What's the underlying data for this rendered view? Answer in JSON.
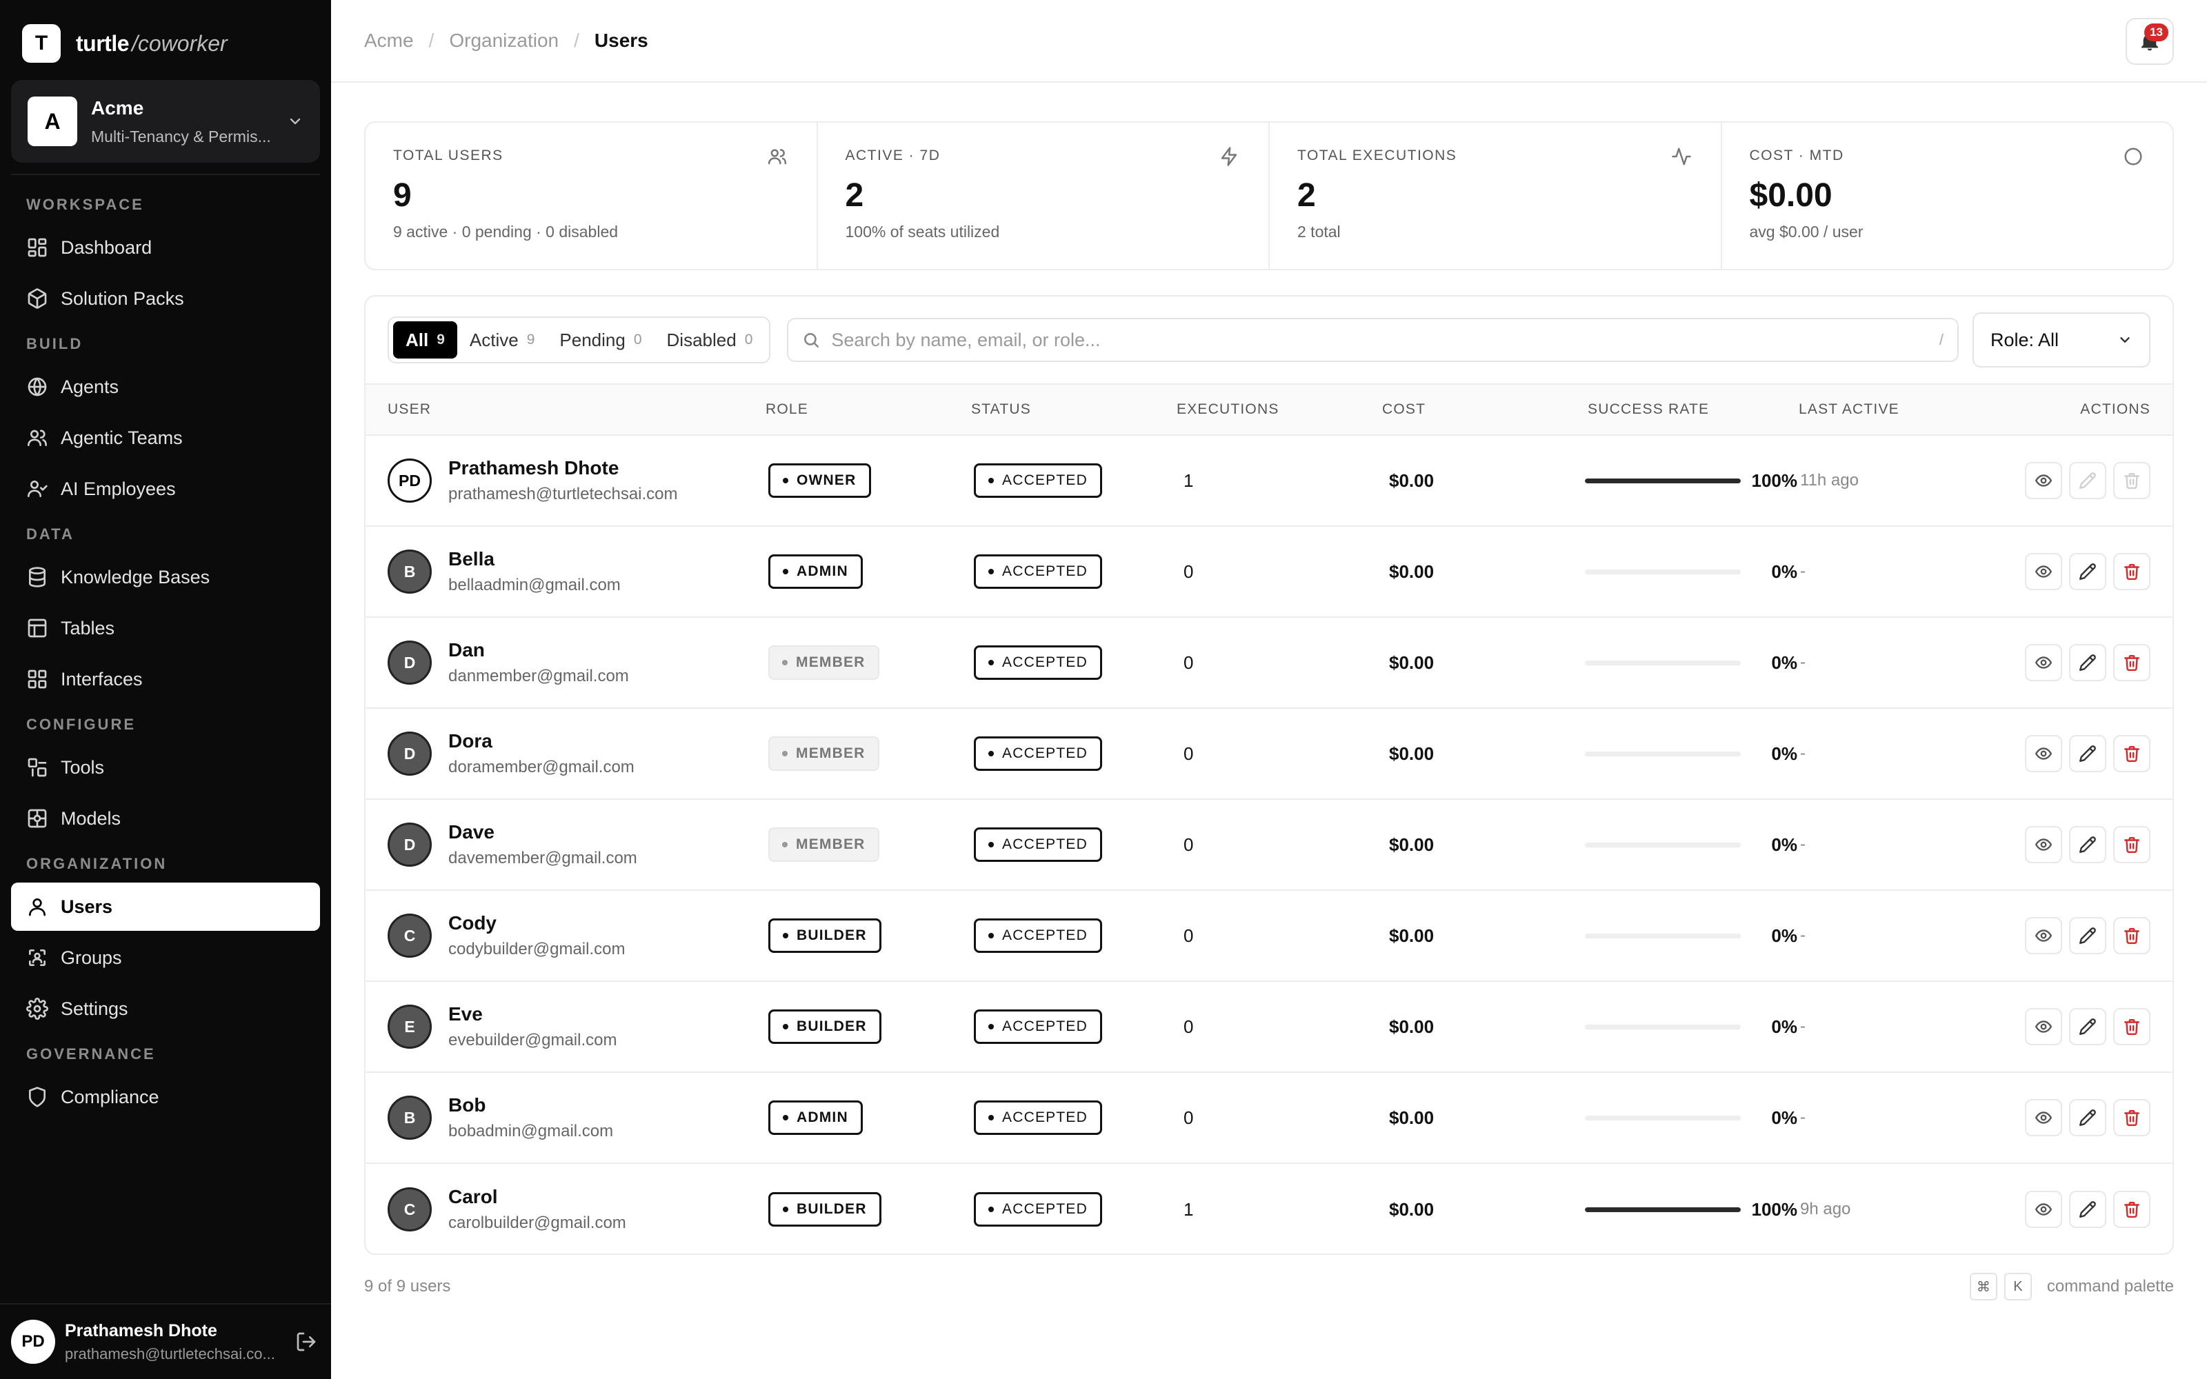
{
  "brand": {
    "logo_letter": "T",
    "name": "turtle",
    "suffix": "/coworker"
  },
  "org": {
    "avatar": "A",
    "name": "Acme",
    "subtitle": "Multi-Tenancy & Permis..."
  },
  "nav": {
    "sections": [
      {
        "title": "WORKSPACE",
        "items": [
          {
            "label": "Dashboard",
            "icon": "dashboard-icon"
          },
          {
            "label": "Solution Packs",
            "icon": "package-icon"
          }
        ]
      },
      {
        "title": "BUILD",
        "items": [
          {
            "label": "Agents",
            "icon": "globe-icon"
          },
          {
            "label": "Agentic Teams",
            "icon": "team-icon"
          },
          {
            "label": "AI Employees",
            "icon": "user-check-icon"
          }
        ]
      },
      {
        "title": "DATA",
        "items": [
          {
            "label": "Knowledge Bases",
            "icon": "database-icon"
          },
          {
            "label": "Tables",
            "icon": "table-icon"
          },
          {
            "label": "Interfaces",
            "icon": "layout-icon"
          }
        ]
      },
      {
        "title": "CONFIGURE",
        "items": [
          {
            "label": "Tools",
            "icon": "tools-icon"
          },
          {
            "label": "Models",
            "icon": "models-icon"
          }
        ]
      },
      {
        "title": "ORGANIZATION",
        "items": [
          {
            "label": "Users",
            "icon": "user-icon",
            "active": true
          },
          {
            "label": "Groups",
            "icon": "groups-icon"
          },
          {
            "label": "Settings",
            "icon": "gear-icon"
          }
        ]
      },
      {
        "title": "GOVERNANCE",
        "items": [
          {
            "label": "Compliance",
            "icon": "shield-icon"
          }
        ]
      }
    ]
  },
  "current_user": {
    "initials": "PD",
    "name": "Prathamesh Dhote",
    "email": "prathamesh@turtletechsai.co..."
  },
  "breadcrumb": [
    "Acme",
    "Organization",
    "Users"
  ],
  "notifications": {
    "count": "13"
  },
  "stats": [
    {
      "label": "TOTAL USERS",
      "value": "9",
      "sub": "9 active · 0 pending · 0 disabled",
      "icon": "users-icon"
    },
    {
      "label": "ACTIVE · 7D",
      "value": "2",
      "sub": "100% of seats utilized",
      "icon": "lightning-icon"
    },
    {
      "label": "TOTAL EXECUTIONS",
      "value": "2",
      "sub": "2 total",
      "icon": "activity-icon"
    },
    {
      "label": "COST · MTD",
      "value": "$0.00",
      "sub": "avg $0.00 / user",
      "icon": "circle-icon"
    }
  ],
  "filters": {
    "tabs": [
      {
        "label": "All",
        "count": "9",
        "active": true
      },
      {
        "label": "Active",
        "count": "9"
      },
      {
        "label": "Pending",
        "count": "0"
      },
      {
        "label": "Disabled",
        "count": "0"
      }
    ],
    "search_placeholder": "Search by name, email, or role...",
    "search_shortcut": "/",
    "role_label": "Role: All"
  },
  "table": {
    "columns": [
      "USER",
      "ROLE",
      "STATUS",
      "EXECUTIONS",
      "COST",
      "SUCCESS RATE",
      "LAST ACTIVE",
      "ACTIONS"
    ],
    "rows": [
      {
        "initials": "PD",
        "name": "Prathamesh Dhote",
        "email": "prathamesh@turtletechsai.com",
        "role": "OWNER",
        "role_style": "outline",
        "status": "ACCEPTED",
        "executions": "1",
        "cost": "$0.00",
        "success": 100,
        "success_label": "100%",
        "last_active": "11h ago",
        "avatar_style": "light",
        "edit_enabled": false,
        "delete_enabled": false
      },
      {
        "initials": "B",
        "name": "Bella",
        "email": "bellaadmin@gmail.com",
        "role": "ADMIN",
        "role_style": "outline",
        "status": "ACCEPTED",
        "executions": "0",
        "cost": "$0.00",
        "success": 0,
        "success_label": "0%",
        "last_active": "-",
        "avatar_style": "dark",
        "edit_enabled": true,
        "delete_enabled": true
      },
      {
        "initials": "D",
        "name": "Dan",
        "email": "danmember@gmail.com",
        "role": "MEMBER",
        "role_style": "muted",
        "status": "ACCEPTED",
        "executions": "0",
        "cost": "$0.00",
        "success": 0,
        "success_label": "0%",
        "last_active": "-",
        "avatar_style": "dark",
        "edit_enabled": true,
        "delete_enabled": true
      },
      {
        "initials": "D",
        "name": "Dora",
        "email": "doramember@gmail.com",
        "role": "MEMBER",
        "role_style": "muted",
        "status": "ACCEPTED",
        "executions": "0",
        "cost": "$0.00",
        "success": 0,
        "success_label": "0%",
        "last_active": "-",
        "avatar_style": "dark",
        "edit_enabled": true,
        "delete_enabled": true
      },
      {
        "initials": "D",
        "name": "Dave",
        "email": "davemember@gmail.com",
        "role": "MEMBER",
        "role_style": "muted",
        "status": "ACCEPTED",
        "executions": "0",
        "cost": "$0.00",
        "success": 0,
        "success_label": "0%",
        "last_active": "-",
        "avatar_style": "dark",
        "edit_enabled": true,
        "delete_enabled": true
      },
      {
        "initials": "C",
        "name": "Cody",
        "email": "codybuilder@gmail.com",
        "role": "BUILDER",
        "role_style": "outline",
        "status": "ACCEPTED",
        "executions": "0",
        "cost": "$0.00",
        "success": 0,
        "success_label": "0%",
        "last_active": "-",
        "avatar_style": "dark",
        "edit_enabled": true,
        "delete_enabled": true
      },
      {
        "initials": "E",
        "name": "Eve",
        "email": "evebuilder@gmail.com",
        "role": "BUILDER",
        "role_style": "outline",
        "status": "ACCEPTED",
        "executions": "0",
        "cost": "$0.00",
        "success": 0,
        "success_label": "0%",
        "last_active": "-",
        "avatar_style": "dark",
        "edit_enabled": true,
        "delete_enabled": true
      },
      {
        "initials": "B",
        "name": "Bob",
        "email": "bobadmin@gmail.com",
        "role": "ADMIN",
        "role_style": "outline",
        "status": "ACCEPTED",
        "executions": "0",
        "cost": "$0.00",
        "success": 0,
        "success_label": "0%",
        "last_active": "-",
        "avatar_style": "dark",
        "edit_enabled": true,
        "delete_enabled": true
      },
      {
        "initials": "C",
        "name": "Carol",
        "email": "carolbuilder@gmail.com",
        "role": "BUILDER",
        "role_style": "outline",
        "status": "ACCEPTED",
        "executions": "1",
        "cost": "$0.00",
        "success": 100,
        "success_label": "100%",
        "last_active": "9h ago",
        "avatar_style": "dark",
        "edit_enabled": true,
        "delete_enabled": true
      }
    ]
  },
  "footer": {
    "count_text": "9 of 9 users",
    "shortcut_keys": [
      "⌘",
      "K"
    ],
    "shortcut_label": "command palette"
  },
  "colors": {
    "sidebar_bg": "#0b0b0c",
    "accent": "#000000",
    "danger": "#d62828"
  }
}
